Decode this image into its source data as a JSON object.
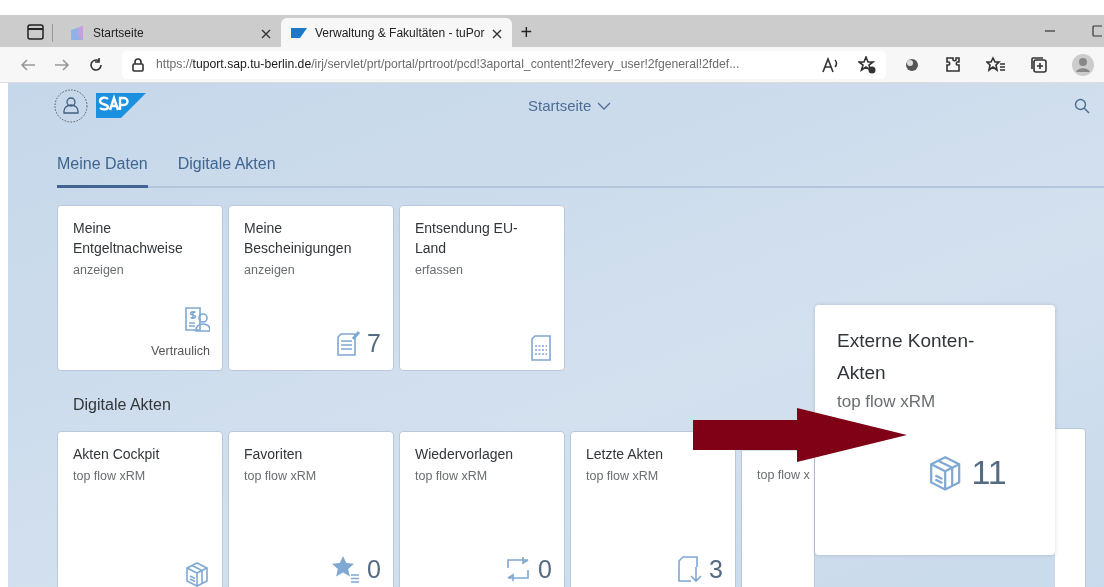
{
  "browser": {
    "tabs": [
      {
        "title": "Startseite",
        "selected": false
      },
      {
        "title": "Verwaltung & Fakultäten - tuPor",
        "selected": true
      }
    ],
    "new_tab": "+",
    "url": {
      "scheme": "https://",
      "host": "tuport.sap.tu-berlin.de",
      "path": "/irj/servlet/prt/portal/prtroot/pcd!3aportal_content!2fevery_user!2fgeneral!2fdef..."
    }
  },
  "shell": {
    "title": "Startseite"
  },
  "tabs": [
    {
      "label": "Meine Daten",
      "selected": true
    },
    {
      "label": "Digitale Akten",
      "selected": false
    }
  ],
  "sections": [
    {
      "tiles": [
        {
          "title": "Meine Entgeltnachweise",
          "subtitle": "anzeigen",
          "footer": "Vertraulich"
        },
        {
          "title": "Meine Bescheinigungen",
          "subtitle": "anzeigen",
          "count": "7"
        },
        {
          "title": "Entsendung EU-Land",
          "subtitle": "erfassen"
        }
      ]
    },
    {
      "heading": "Digitale Akten",
      "tiles": [
        {
          "title": "Akten Cockpit",
          "subtitle": "top flow xRM"
        },
        {
          "title": "Favoriten",
          "subtitle": "top flow xRM",
          "count": "0"
        },
        {
          "title": "Wiedervorlagen",
          "subtitle": "top flow xRM",
          "count": "0"
        },
        {
          "title": "Letzte Akten",
          "subtitle": "top flow xRM",
          "count": "3"
        },
        {
          "subtitle": "top flow x"
        }
      ]
    }
  ],
  "zoomed_tile": {
    "title": "Externe Konten-Akten",
    "subtitle": "top flow xRM",
    "count": "11"
  }
}
